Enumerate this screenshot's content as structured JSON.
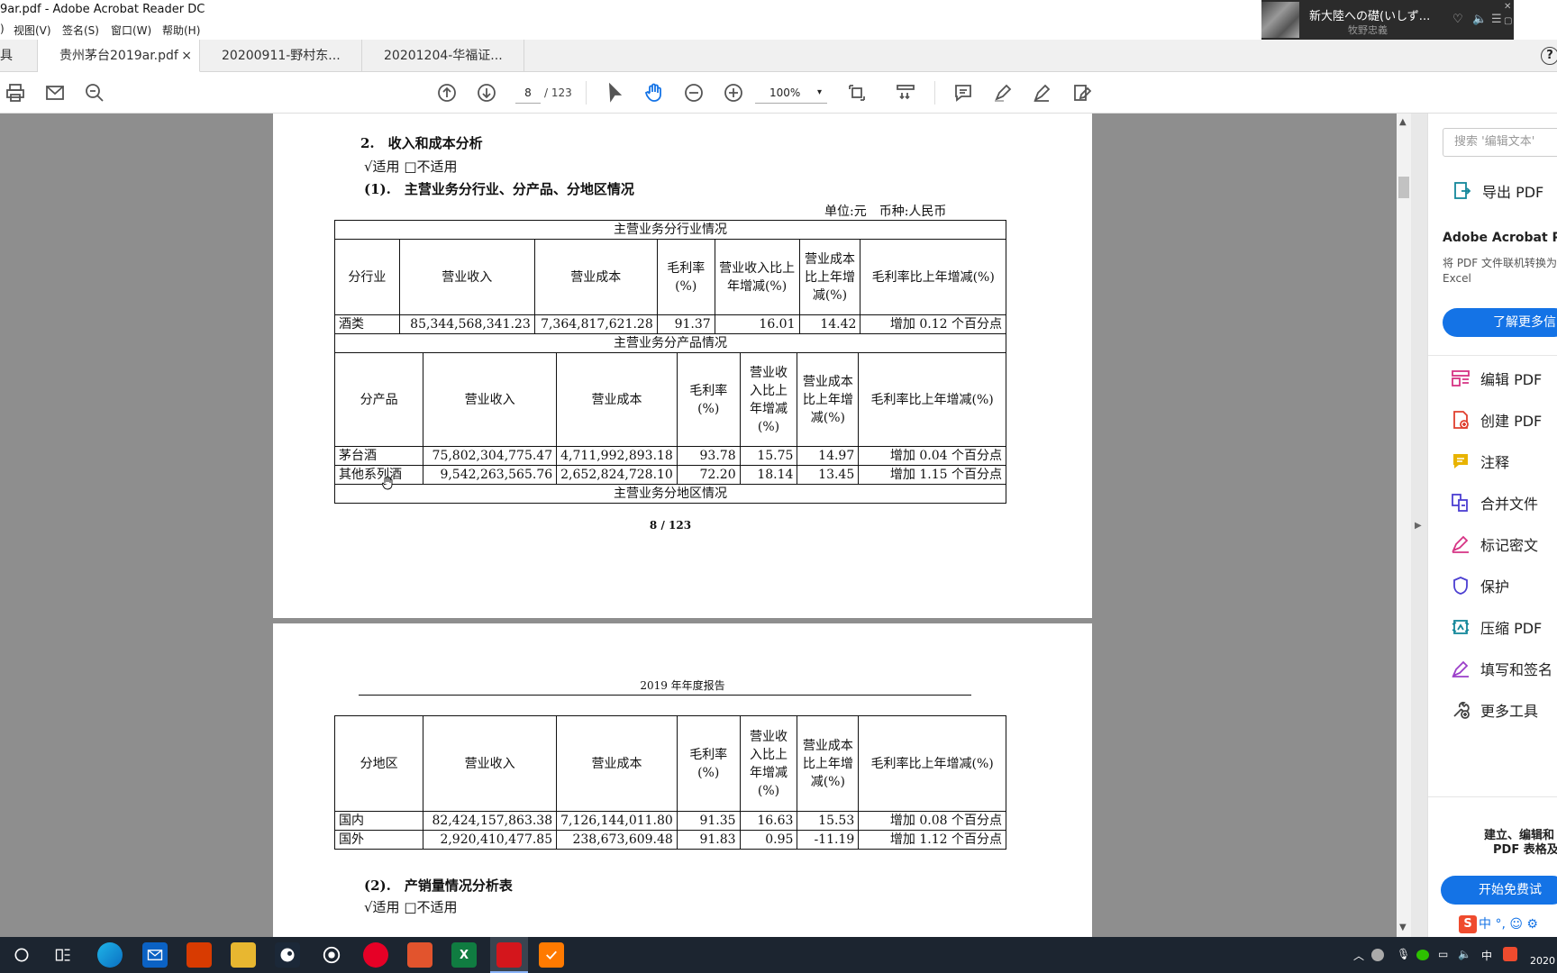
{
  "window": {
    "title": "9ar.pdf - Adobe Acrobat Reader DC"
  },
  "menu": {
    "items": [
      ")",
      "视图(V)",
      "签名(S)",
      "窗口(W)",
      "帮助(H)"
    ]
  },
  "media": {
    "song": "新大陸への礎(いしず...",
    "artist": "牧野忠義",
    "controls": [
      "♡",
      "🔈",
      "☰",
      "✕",
      "▢"
    ]
  },
  "tabs": {
    "home": "具",
    "items": [
      {
        "label": "贵州茅台2019ar.pdf",
        "close": "×"
      },
      {
        "label": "20200911-野村东..."
      },
      {
        "label": "20201204-华福证..."
      }
    ],
    "help": "?"
  },
  "toolbar": {
    "page_current": "8",
    "page_total": "/ 123",
    "zoom": "100%",
    "zoom_caret": "▾"
  },
  "page1": {
    "heading": "2.　收入和成本分析",
    "applicable": "√适用 □不适用",
    "subheading": "(1).　主营业务分行业、分产品、分地区情况",
    "unit": "单位:元　币种:人民币",
    "industry_title": "主营业务分行业情况",
    "industry_headers": [
      "分行业",
      "营业收入",
      "营业成本",
      "毛利率(%)",
      "营业收入比上年增减(%)",
      "营业成本比上年增减(%)",
      "毛利率比上年增减(%)"
    ],
    "industry_row": [
      "酒类",
      "85,344,568,341.23",
      "7,364,817,621.28",
      "91.37",
      "16.01",
      "14.42",
      "增加 0.12 个百分点"
    ],
    "product_title": "主营业务分产品情况",
    "product_headers": [
      "分产品",
      "营业收入",
      "营业成本",
      "毛利率(%)",
      "营业收入比上年增减(%)",
      "营业成本比上年增减(%)",
      "毛利率比上年增减(%)"
    ],
    "product_rows": [
      [
        "茅台酒",
        "75,802,304,775.47",
        "4,711,992,893.18",
        "93.78",
        "15.75",
        "14.97",
        "增加 0.04 个百分点"
      ],
      [
        "其他系列酒",
        "9,542,263,565.76",
        "2,652,824,728.10",
        "72.20",
        "18.14",
        "13.45",
        "增加 1.15 个百分点"
      ]
    ],
    "region_title": "主营业务分地区情况",
    "page_label": "8 / 123"
  },
  "page2": {
    "report_header": "2019 年年度报告",
    "region_headers": [
      "分地区",
      "营业收入",
      "营业成本",
      "毛利率(%)",
      "营业收入比上年增减(%)",
      "营业成本比上年增减(%)",
      "毛利率比上年增减(%)"
    ],
    "region_rows": [
      [
        "国内",
        "82,424,157,863.38",
        "7,126,144,011.80",
        "91.35",
        "16.63",
        "15.53",
        "增加 0.08 个百分点"
      ],
      [
        "国外",
        "2,920,410,477.85",
        "238,673,609.48",
        "91.83",
        "0.95",
        "-11.19",
        "增加 1.12 个百分点"
      ]
    ],
    "subheading2": "(2).　产销量情况分析表",
    "applicable2": "√适用 □不适用"
  },
  "scroll": {
    "up": "▲",
    "down": "▼",
    "collapse": "▶"
  },
  "right_panel": {
    "search_placeholder": "搜索 '编辑文本'",
    "export": "导出 PDF",
    "promo_title": "Adobe Acrobat Pro",
    "promo_desc_1": "将 PDF 文件联机转换为",
    "promo_desc_2": "Excel",
    "learn_more": "了解更多信",
    "tools": [
      "编辑 PDF",
      "创建 PDF",
      "注释",
      "合并文件",
      "标记密文",
      "保护",
      "压缩 PDF",
      "填写和签名",
      "更多工具"
    ],
    "bottom_1": "建立、编辑和",
    "bottom_2": "PDF 表格及签",
    "trial": "开始免费试"
  },
  "ime": {
    "label": "中 °, ☺ ⚙"
  },
  "taskbar": {
    "ime": "中",
    "clock": "2020"
  },
  "colors": {
    "accent": "#1473e6",
    "taskbar": "#1c2530",
    "doc_bg": "#8e8e8e"
  }
}
